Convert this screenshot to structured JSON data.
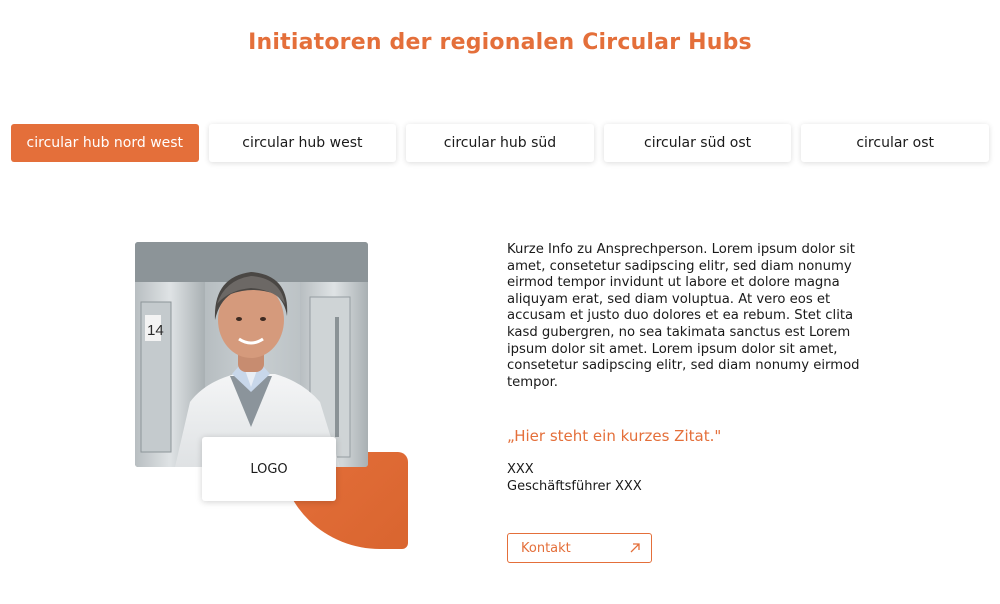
{
  "page": {
    "title": "Initiatoren der regionalen Circular Hubs"
  },
  "tabs": [
    {
      "label": "circular hub nord west",
      "active": true
    },
    {
      "label": "circular hub west",
      "active": false
    },
    {
      "label": "circular hub süd",
      "active": false
    },
    {
      "label": "circular süd ost",
      "active": false
    },
    {
      "label": "circular ost",
      "active": false
    }
  ],
  "profile": {
    "photo_icon": "person-photo",
    "logo_label": "LOGO",
    "info": "Kurze Info zu Ansprechperson. Lorem ipsum dolor sit amet, consetetur sadipscing elitr, sed diam nonumy eirmod tempor invidunt ut labore et dolore magna aliquyam erat, sed diam voluptua. At vero eos et accusam et justo duo dolores et ea rebum. Stet clita kasd gubergren, no sea takimata sanctus est Lorem ipsum dolor sit amet. Lorem ipsum dolor sit amet, consetetur sadipscing elitr, sed diam nonumy eirmod tempor.",
    "quote": "„Hier steht ein kurzes Zitat.\"",
    "name": "XXX",
    "role": "Geschäftsführer XXX",
    "contact_label": "Kontakt",
    "contact_icon": "arrow-up-right-icon"
  },
  "colors": {
    "accent": "#e46f3a",
    "text": "#1a1a1a",
    "background": "#ffffff"
  }
}
